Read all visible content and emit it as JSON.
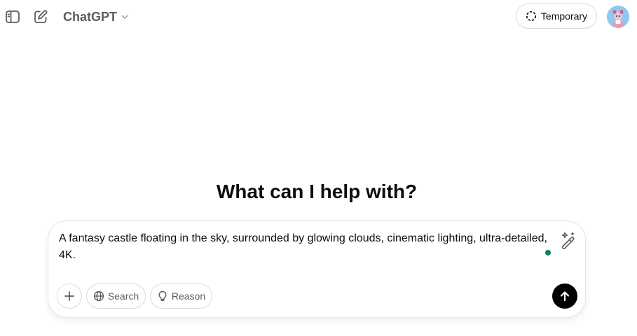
{
  "header": {
    "sidebar_toggle_icon": "sidebar-toggle-icon",
    "new_chat_icon": "new-chat-icon",
    "model_name": "ChatGPT",
    "model_chevron_icon": "chevron-down-icon",
    "temporary_label": "Temporary",
    "temporary_icon": "dashed-circle-icon",
    "avatar_icon": "user-avatar"
  },
  "main": {
    "headline": "What can I help with?"
  },
  "composer": {
    "prompt_text": "A fantasy castle floating in the sky, surrounded by glowing clouds, cinematic lighting, ultra-detailed,\n4K.",
    "magic_icon": "magic-wand-icon",
    "tools": {
      "attach_icon": "plus-icon",
      "search_label": "Search",
      "search_icon": "globe-icon",
      "reason_label": "Reason",
      "reason_icon": "lightbulb-icon"
    },
    "send_icon": "arrow-up-icon"
  },
  "colors": {
    "send_button": "#000000",
    "status_dot": "#12805c",
    "avatar_bg": "#8fc8ee",
    "muted_text": "#5d5d5d"
  }
}
